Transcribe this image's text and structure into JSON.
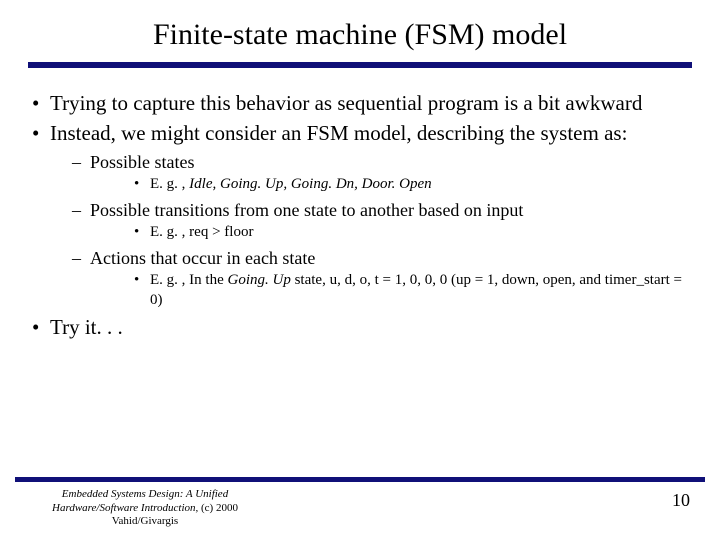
{
  "title": "Finite-state machine (FSM) model",
  "bullets": {
    "b1": "Trying to capture this behavior as sequential program is a bit awkward",
    "b2": "Instead, we might consider an FSM model, describing the system as:",
    "s1": "Possible states",
    "s1e_pre": "E. g. , ",
    "s1e_it": "Idle, Going. Up, Going. Dn, Door. Open",
    "s2": "Possible transitions from one state to another based on input",
    "s2e": "E. g. , req > floor",
    "s3": "Actions that occur in each state",
    "s3e_a": "E. g. , In the ",
    "s3e_it": "Going. Up",
    "s3e_b": " state, u, d, o, t = 1, 0, 0, 0 (up = 1, down, open, and timer_start = 0)",
    "b3": "Try it. . ."
  },
  "footer": {
    "line1": "Embedded Systems Design: A Unified",
    "line2_it": "Hardware/Software Introduction,",
    "line2_rest": " (c) 2000 Vahid/Givargis",
    "page": "10"
  }
}
